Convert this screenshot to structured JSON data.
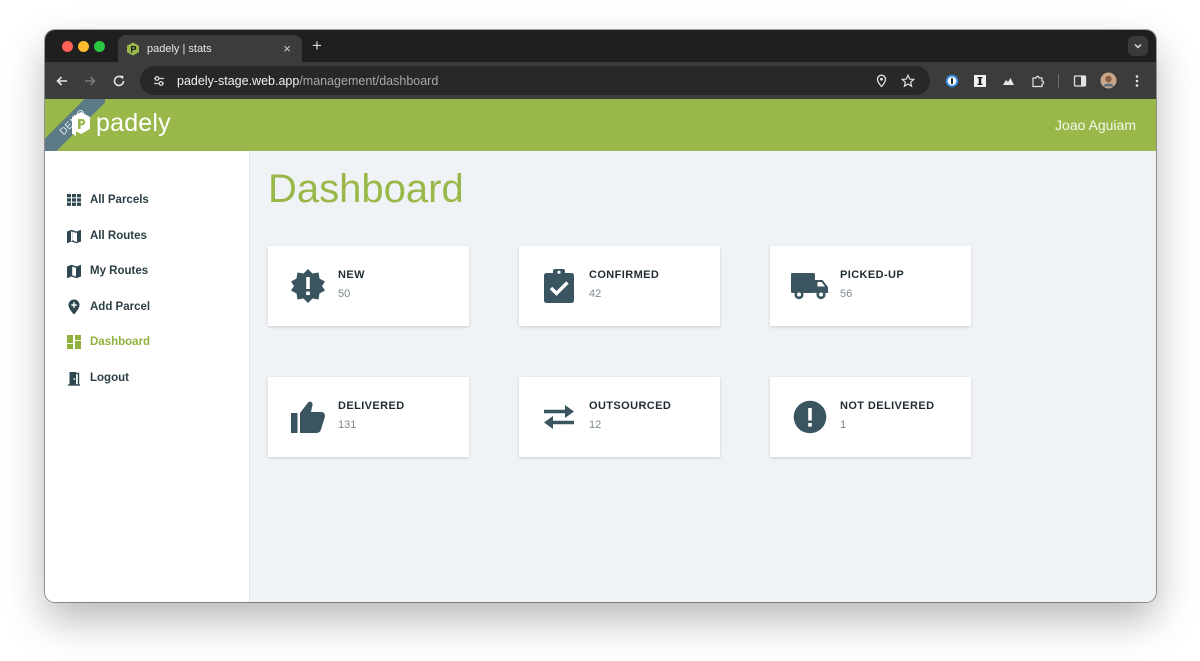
{
  "browser": {
    "tab_title": "padely | stats",
    "url_host": "padely-stage.web.app",
    "url_path": "/management/dashboard"
  },
  "header": {
    "ribbon": "DEMO",
    "logo_text": "padely",
    "user_name": "Joao Aguiam",
    "color": "#9ab84a"
  },
  "sidebar": {
    "items": [
      {
        "label": "All Parcels",
        "icon": "grid-icon"
      },
      {
        "label": "All Routes",
        "icon": "map-icon"
      },
      {
        "label": "My Routes",
        "icon": "map-icon"
      },
      {
        "label": "Add Parcel",
        "icon": "add-location-icon"
      },
      {
        "label": "Dashboard",
        "icon": "dashboard-icon",
        "active": true
      },
      {
        "label": "Logout",
        "icon": "door-icon"
      }
    ]
  },
  "main": {
    "title": "Dashboard",
    "cards": [
      {
        "label": "NEW",
        "count": "50",
        "icon": "new-releases-icon"
      },
      {
        "label": "CONFIRMED",
        "count": "42",
        "icon": "clipboard-check-icon"
      },
      {
        "label": "PICKED-UP",
        "count": "56",
        "icon": "truck-icon"
      },
      {
        "label": "DELIVERED",
        "count": "131",
        "icon": "thumbs-up-icon"
      },
      {
        "label": "OUTSOURCED",
        "count": "12",
        "icon": "swap-arrows-icon"
      },
      {
        "label": "NOT DELIVERED",
        "count": "1",
        "icon": "error-icon"
      }
    ]
  }
}
